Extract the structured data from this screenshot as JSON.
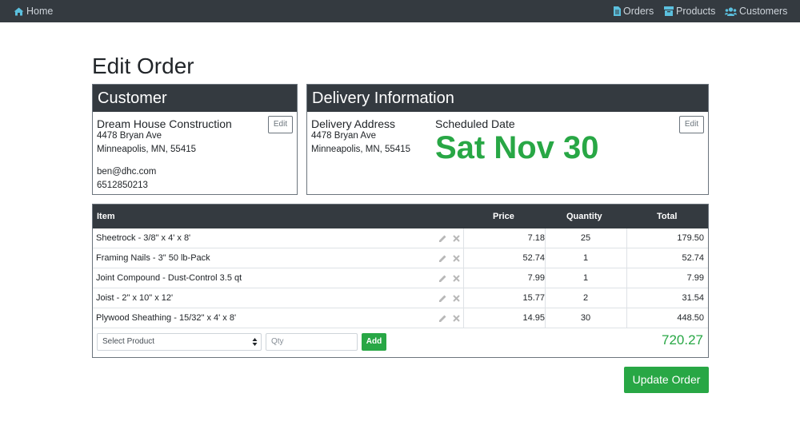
{
  "nav": {
    "home": "Home",
    "orders": "Orders",
    "products": "Products",
    "customers": "Customers"
  },
  "page_title": "Edit Order",
  "customer": {
    "header": "Customer",
    "edit_label": "Edit",
    "name": "Dream House Construction",
    "street": "4478 Bryan Ave",
    "city_line": "Minneapolis, MN, 55415",
    "email": "ben@dhc.com",
    "phone": "6512850213"
  },
  "delivery": {
    "header": "Delivery Information",
    "edit_label": "Edit",
    "address_label": "Delivery Address",
    "street": "4478 Bryan Ave",
    "city_line": "Minneapolis, MN, 55415",
    "scheduled_label": "Scheduled Date",
    "scheduled_date": "Sat Nov 30"
  },
  "table": {
    "headers": {
      "item": "Item",
      "price": "Price",
      "quantity": "Quantity",
      "total": "Total"
    },
    "rows": [
      {
        "item": "Sheetrock - 3/8\" x 4' x 8'",
        "price": "7.18",
        "qty": "25",
        "total": "179.50"
      },
      {
        "item": "Framing Nails - 3\" 50 lb-Pack",
        "price": "52.74",
        "qty": "1",
        "total": "52.74"
      },
      {
        "item": "Joint Compound - Dust-Control 3.5 qt",
        "price": "7.99",
        "qty": "1",
        "total": "7.99"
      },
      {
        "item": "Joist - 2\" x 10\" x 12'",
        "price": "15.77",
        "qty": "2",
        "total": "31.54"
      },
      {
        "item": "Plywood Sheathing - 15/32\" x 4' x 8'",
        "price": "14.95",
        "qty": "30",
        "total": "448.50"
      }
    ],
    "select_placeholder": "Select Product",
    "qty_placeholder": "Qty",
    "add_label": "Add",
    "grand_total": "720.27"
  },
  "update_label": "Update Order",
  "colors": {
    "navbar": "#343a40",
    "accent": "#28a745",
    "nav_icon": "#5bc0de"
  },
  "icons": [
    "home-icon",
    "file-icon",
    "products-icon",
    "users-icon",
    "pencil-icon",
    "close-icon",
    "sort-arrows-icon"
  ]
}
